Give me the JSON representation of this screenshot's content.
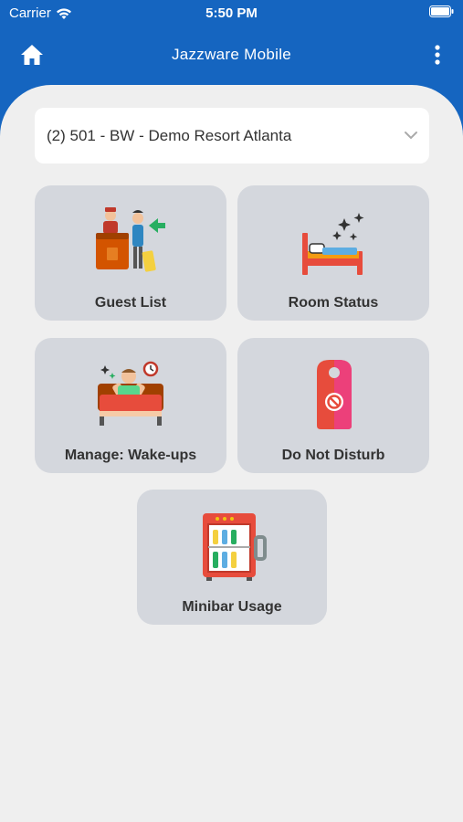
{
  "status_bar": {
    "carrier": "Carrier",
    "time": "5:50 PM"
  },
  "header": {
    "title": "Jazzware Mobile",
    "home_icon": "home-icon",
    "menu_icon": "more-vertical-icon"
  },
  "property_selector": {
    "value": "(2) 501 - BW - Demo Resort Atlanta"
  },
  "tiles": [
    {
      "label": "Guest List",
      "icon": "bellhop-guest-icon"
    },
    {
      "label": "Room Status",
      "icon": "clean-bed-icon"
    },
    {
      "label": "Manage: Wake-ups",
      "icon": "wake-up-icon"
    },
    {
      "label": "Do Not Disturb",
      "icon": "door-hanger-icon"
    },
    {
      "label": "Minibar Usage",
      "icon": "minibar-fridge-icon"
    }
  ],
  "colors": {
    "header": "#1565c0",
    "background": "#efefef",
    "tile": "#d4d7dd"
  }
}
